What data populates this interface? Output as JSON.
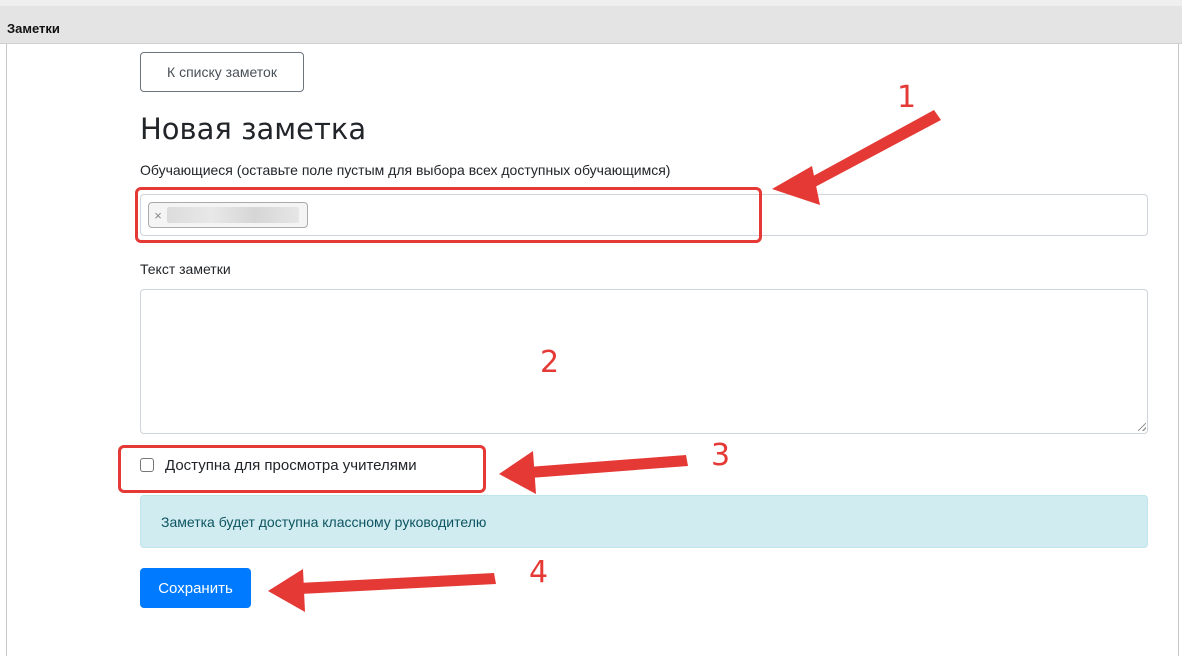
{
  "window": {
    "title": "Заметки"
  },
  "nav": {
    "back_label": "К списку заметок"
  },
  "page": {
    "heading": "Новая заметка"
  },
  "students": {
    "label": "Обучающиеся (оставьте поле пустым для выбора всех доступных обучающимся)",
    "chip_remove": "×"
  },
  "note": {
    "label": "Текст заметки",
    "value": ""
  },
  "visibility": {
    "checkbox_label": "Доступна для просмотра учителями",
    "checked": false
  },
  "info": {
    "message": "Заметка будет доступна классному руководителю"
  },
  "actions": {
    "save_label": "Сохранить"
  },
  "annotations": {
    "numbers": [
      "1",
      "2",
      "3",
      "4"
    ],
    "color": "#e53935"
  },
  "colors": {
    "primary": "#007bff",
    "info_bg": "#d1ecf1",
    "info_text": "#0c5460"
  }
}
